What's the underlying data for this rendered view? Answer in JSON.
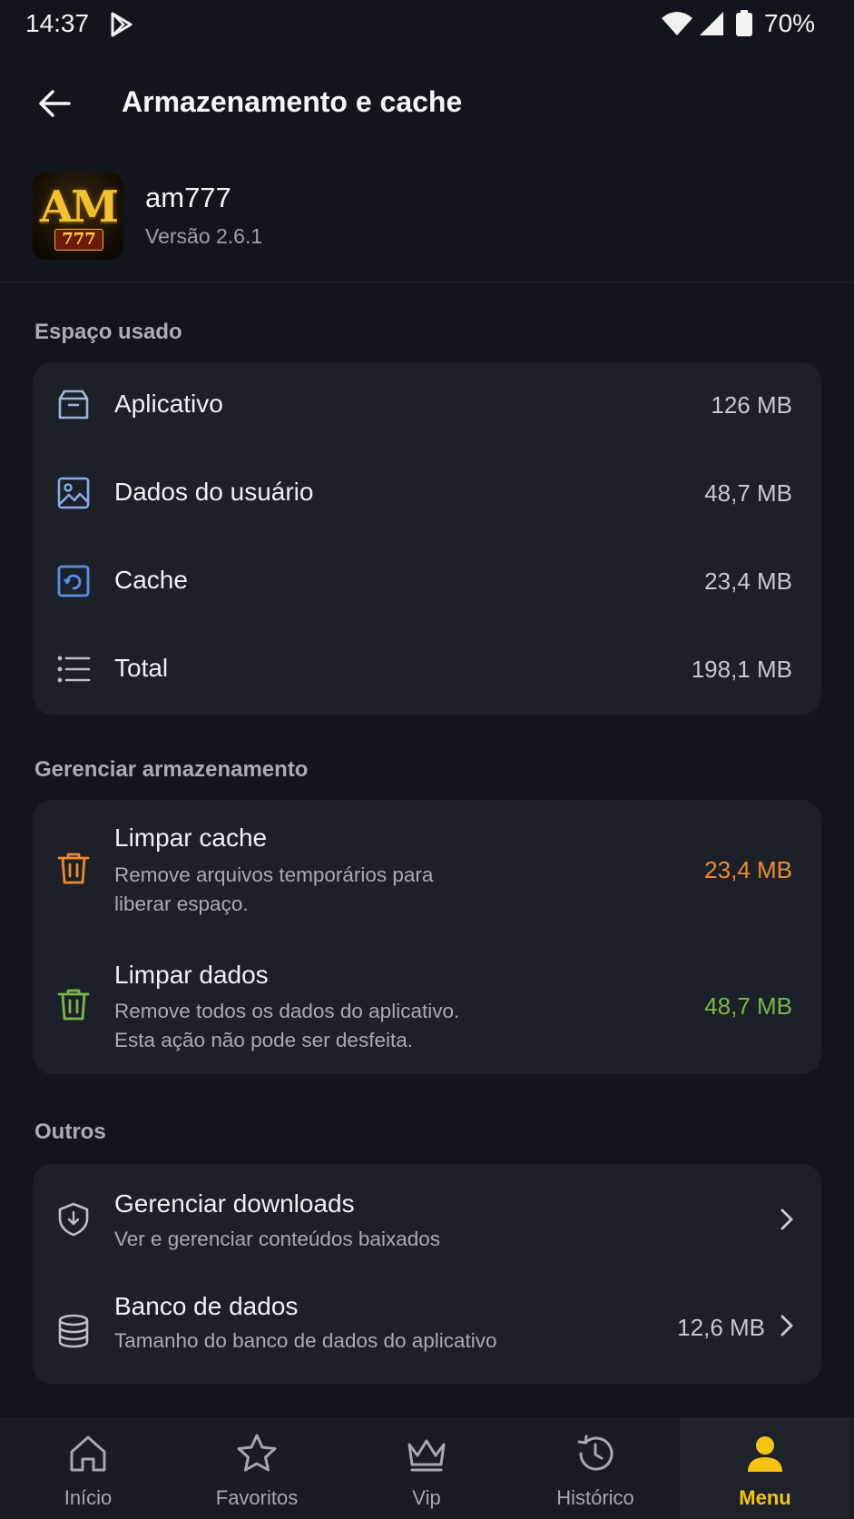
{
  "status_bar": {
    "time": "14:37",
    "battery_percent": "70%"
  },
  "app_bar": {
    "title": "Armazenamento e cache"
  },
  "app_info": {
    "logo_text": "AM",
    "logo_sub": "777",
    "name": "am777",
    "version": "Versão 2.6.1"
  },
  "usage": {
    "title": "Espaço usado",
    "rows": [
      {
        "label": "Aplicativo",
        "value": "126 MB",
        "icon": "package-icon"
      },
      {
        "label": "Dados do usuário",
        "value": "48,7 MB",
        "icon": "image-icon"
      },
      {
        "label": "Cache",
        "value": "23,4 MB",
        "icon": "cache-icon"
      },
      {
        "label": "Total",
        "value": "198,1 MB",
        "icon": "list-icon"
      }
    ]
  },
  "manage": {
    "title": "Gerenciar armazenamento",
    "clear_cache": {
      "label": "Limpar cache",
      "sub1": "Remove arquivos temporários para",
      "sub2": "liberar espaço.",
      "value": "23,4 MB",
      "color": "#f08a2c"
    },
    "clear_data": {
      "label": "Limpar dados",
      "sub1": "Remove todos os dados do aplicativo.",
      "sub2": "Esta ação não pode ser desfeita.",
      "value": "48,7 MB",
      "color": "#7ab648"
    }
  },
  "others": {
    "title": "Outros",
    "downloads": {
      "label": "Gerenciar downloads",
      "sub": "Ver e gerenciar conteúdos baixados"
    },
    "database": {
      "label": "Banco de dados",
      "sub": "Tamanho do banco de dados do aplicativo",
      "value": "12,6 MB"
    }
  },
  "bottom_nav": {
    "items": [
      {
        "label": "Início",
        "icon": "home-icon"
      },
      {
        "label": "Favoritos",
        "icon": "star-icon"
      },
      {
        "label": "Vip",
        "icon": "crown-icon"
      },
      {
        "label": "Histórico",
        "icon": "history-icon"
      },
      {
        "label": "Menu",
        "icon": "user-icon",
        "active": true
      }
    ],
    "active_color": "#f5c414"
  }
}
